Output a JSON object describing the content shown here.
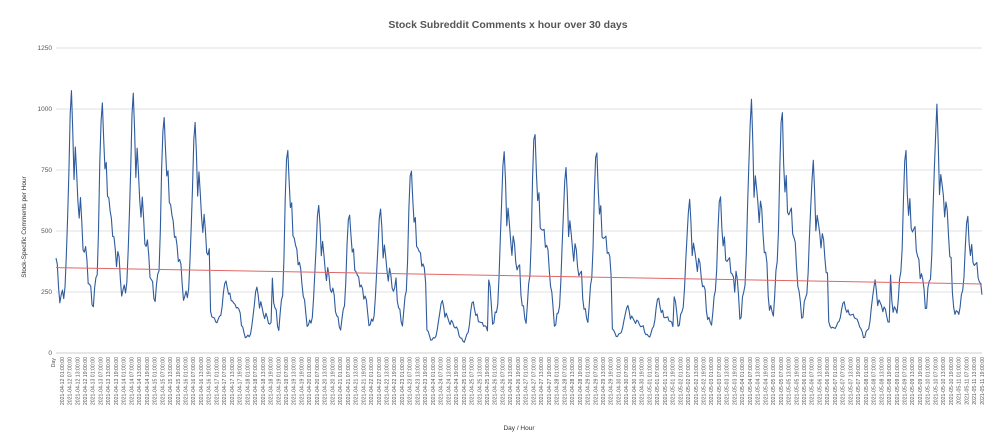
{
  "chart_data": {
    "type": "line",
    "title": "Stock Subreddit Comments x hour over 30 days",
    "xlabel": "Day / Hour",
    "ylabel": "Stock-Specific Comments per Hour",
    "x_axis_corner_label": "Day",
    "ylim": [
      0,
      1250
    ],
    "y_ticks": [
      0,
      250,
      500,
      750,
      1000,
      1250
    ],
    "grid": true,
    "x_tick_labels": [
      "2021-04-12 01:00:00",
      "2021-04-12 07:00:00",
      "2021-04-12 13:00:00",
      "2021-04-12 19:00:00",
      "2021-04-13 01:00:00",
      "2021-04-13 07:00:00",
      "2021-04-13 13:00:00",
      "2021-04-13 19:00:00",
      "2021-04-14 01:00:00",
      "2021-04-14 07:00:00",
      "2021-04-14 13:00:00",
      "2021-04-14 19:00:00",
      "2021-04-15 01:00:00",
      "2021-04-15 07:00:00",
      "2021-04-15 13:00:00",
      "2021-04-15 19:00:00",
      "2021-04-16 01:00:00",
      "2021-04-16 07:00:00",
      "2021-04-16 13:00:00",
      "2021-04-16 19:00:00",
      "2021-04-17 01:00:00",
      "2021-04-17 07:00:00",
      "2021-04-17 13:00:00",
      "2021-04-17 19:00:00",
      "2021-04-18 01:00:00",
      "2021-04-18 07:00:00",
      "2021-04-18 13:00:00",
      "2021-04-18 19:00:00",
      "2021-04-19 01:00:00",
      "2021-04-19 07:00:00",
      "2021-04-19 13:00:00",
      "2021-04-19 19:00:00",
      "2021-04-20 01:00:00",
      "2021-04-20 07:00:00",
      "2021-04-20 13:00:00",
      "2021-04-20 19:00:00",
      "2021-04-21 01:00:00",
      "2021-04-21 07:00:00",
      "2021-04-21 13:00:00",
      "2021-04-21 19:00:00",
      "2021-04-22 01:00:00",
      "2021-04-22 07:00:00",
      "2021-04-22 13:00:00",
      "2021-04-22 19:00:00",
      "2021-04-23 01:00:00",
      "2021-04-23 07:00:00",
      "2021-04-23 13:00:00",
      "2021-04-23 19:00:00",
      "2021-04-24 01:00:00",
      "2021-04-24 07:00:00",
      "2021-04-24 13:00:00",
      "2021-04-24 19:00:00",
      "2021-04-25 01:00:00",
      "2021-04-25 07:00:00",
      "2021-04-25 13:00:00",
      "2021-04-25 19:00:00",
      "2021-04-26 01:00:00",
      "2021-04-26 07:00:00",
      "2021-04-26 13:00:00",
      "2021-04-26 19:00:00",
      "2021-04-27 01:00:00",
      "2021-04-27 07:00:00",
      "2021-04-27 13:00:00",
      "2021-04-27 19:00:00",
      "2021-04-28 01:00:00",
      "2021-04-28 07:00:00",
      "2021-04-28 13:00:00",
      "2021-04-28 19:00:00",
      "2021-04-29 01:00:00",
      "2021-04-29 07:00:00",
      "2021-04-29 13:00:00",
      "2021-04-29 19:00:00",
      "2021-04-30 01:00:00",
      "2021-04-30 07:00:00",
      "2021-04-30 13:00:00",
      "2021-04-30 19:00:00",
      "2021-05-01 01:00:00",
      "2021-05-01 07:00:00",
      "2021-05-01 13:00:00",
      "2021-05-01 19:00:00",
      "2021-05-02 01:00:00",
      "2021-05-02 07:00:00",
      "2021-05-02 13:00:00",
      "2021-05-02 19:00:00",
      "2021-05-03 01:00:00",
      "2021-05-03 07:00:00",
      "2021-05-03 13:00:00",
      "2021-05-03 19:00:00",
      "2021-05-04 01:00:00",
      "2021-05-04 07:00:00",
      "2021-05-04 13:00:00",
      "2021-05-04 19:00:00",
      "2021-05-05 01:00:00",
      "2021-05-05 07:00:00",
      "2021-05-05 13:00:00",
      "2021-05-05 19:00:00",
      "2021-05-06 01:00:00",
      "2021-05-06 07:00:00",
      "2021-05-06 13:00:00",
      "2021-05-06 19:00:00",
      "2021-05-07 01:00:00",
      "2021-05-07 07:00:00",
      "2021-05-07 13:00:00",
      "2021-05-07 19:00:00",
      "2021-05-08 01:00:00",
      "2021-05-08 07:00:00",
      "2021-05-08 13:00:00",
      "2021-05-08 19:00:00",
      "2021-05-09 01:00:00",
      "2021-05-09 07:00:00",
      "2021-05-09 13:00:00",
      "2021-05-09 19:00:00",
      "2021-05-10 01:00:00",
      "2021-05-10 07:00:00",
      "2021-05-10 13:00:00",
      "2021-05-10 19:00:00",
      "2021-05-11 01:00:00",
      "2021-05-11 07:00:00",
      "2021-05-11 13:00:00",
      "2021-05-11 19:00:00"
    ],
    "series": [
      {
        "color": "#2e5b9e",
        "x": [
          "2021-04-12 00:00:00",
          "2021-05-11 23:00:00"
        ],
        "step": "1 hour",
        "daily_profile": {
          "hour_of_day": [
            0,
            1,
            2,
            3,
            4,
            5,
            6,
            7,
            8,
            9,
            10,
            11,
            12,
            13,
            14,
            15,
            16,
            17,
            18,
            19,
            20,
            21,
            22,
            23
          ],
          "profile": [
            0.3,
            0.22,
            0.16,
            0.12,
            0.1,
            0.12,
            0.16,
            0.22,
            0.3,
            0.48,
            0.72,
            0.92,
            1.0,
            0.82,
            0.64,
            0.72,
            0.6,
            0.55,
            0.5,
            0.54,
            0.46,
            0.4,
            0.36,
            0.32
          ]
        },
        "daily_peaks": [
          1075,
          1025,
          1065,
          965,
          945,
          295,
          270,
          830,
          605,
          565,
          590,
          745,
          215,
          210,
          825,
          895,
          760,
          820,
          195,
          225,
          630,
          640,
          1040,
          985,
          790,
          210,
          300,
          830,
          1020,
          560
        ],
        "daily_troughs": [
          95,
          100,
          130,
          140,
          130,
          110,
          40,
          40,
          60,
          65,
          70,
          75,
          40,
          35,
          70,
          80,
          70,
          85,
          60,
          55,
          80,
          75,
          85,
          80,
          100,
          90,
          45,
          90,
          110,
          110
        ]
      }
    ],
    "trendline": {
      "color": "#e06666",
      "start_value": 350,
      "end_value": 283
    }
  }
}
